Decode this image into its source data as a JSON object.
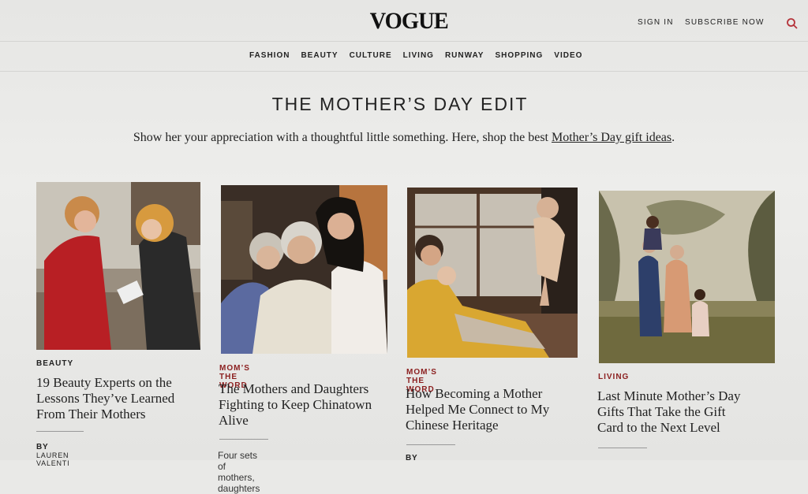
{
  "header": {
    "logo": "VOGUE",
    "sign_in": "SIGN IN",
    "subscribe": "SUBSCRIBE NOW",
    "search_icon": "search-icon"
  },
  "nav": {
    "items": [
      "FASHION",
      "BEAUTY",
      "CULTURE",
      "LIVING",
      "RUNWAY",
      "SHOPPING",
      "VIDEO"
    ]
  },
  "main": {
    "title": "THE MOTHER’S DAY EDIT",
    "intro_text": "Show her your appreciation with a thoughtful little something. Here, shop the best ",
    "intro_link": "Mother’s Day gift ideas",
    "intro_end": "."
  },
  "cards": [
    {
      "rubric": "BEAUTY",
      "rubric_color": "#222222",
      "headline_lines": [
        "19 Beauty Experts on the",
        "Lessons They’ve Learned",
        "From Their Mothers"
      ],
      "byline_prefix": "BY",
      "byline_name": "LAUREN VALENTI"
    },
    {
      "rubric": "MOM’S THE WORD",
      "rubric_color": "#8b1e1e",
      "headline_lines": [
        "The Mothers and Daughters",
        "Fighting to Keep Chinatown",
        "Alive"
      ],
      "dek": "Four sets of mothers, daughters"
    },
    {
      "rubric": "MOM’S THE WORD",
      "rubric_color": "#8b1e1e",
      "headline_lines": [
        "How Becoming a Mother",
        "Helped Me Connect to My",
        "Chinese Heritage"
      ],
      "byline_prefix": "BY"
    },
    {
      "rubric": "LIVING",
      "rubric_color": "#8b1e1e",
      "headline_lines": [
        "Last Minute Mother’s Day",
        "Gifts That Take the Gift",
        "Card to the Next Level"
      ]
    }
  ]
}
